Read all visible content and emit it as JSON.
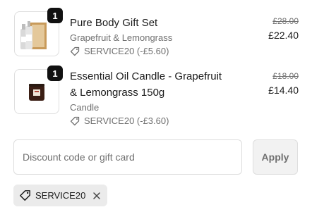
{
  "cart": {
    "items": [
      {
        "quantity": "1",
        "title": "Pure Body Gift Set",
        "variant": "Grapefruit & Lemongrass",
        "discount": "SERVICE20 (-£5.60)",
        "original_price": "£28.00",
        "price": "£22.40"
      },
      {
        "quantity": "1",
        "title": "Essential Oil Candle - Grapefruit & Lemongrass 150g",
        "variant": "Candle",
        "discount": "SERVICE20 (-£3.60)",
        "original_price": "£18.00",
        "price": "£14.40"
      }
    ]
  },
  "discount_form": {
    "placeholder": "Discount code or gift card",
    "apply_label": "Apply"
  },
  "applied_code": {
    "code": "SERVICE20"
  },
  "colors": {
    "badge": "#111111",
    "muted_text": "#707070",
    "tag_background": "#ebebeb",
    "apply_background": "#f2f2f2"
  },
  "icons": [
    "tag-icon",
    "close-icon"
  ]
}
